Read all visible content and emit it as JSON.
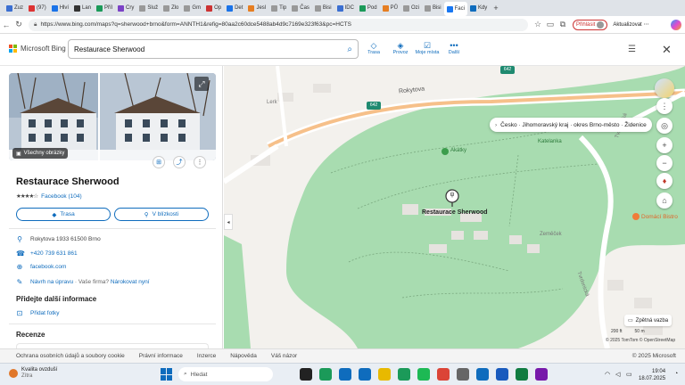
{
  "browser": {
    "tabs": [
      {
        "label": "Zuz",
        "color": "#3b6fd1"
      },
      {
        "label": "(97)",
        "color": "#d33"
      },
      {
        "label": "Hlví",
        "color": "#1a73e8"
      },
      {
        "label": "Lan",
        "color": "#333"
      },
      {
        "label": "Příl",
        "color": "#1b9a59"
      },
      {
        "label": "Cry",
        "color": "#7b42c6"
      },
      {
        "label": "Služ",
        "color": "#999"
      },
      {
        "label": "Zlo",
        "color": "#999"
      },
      {
        "label": "Gm",
        "color": "#999"
      },
      {
        "label": "Op",
        "color": "#c33"
      },
      {
        "label": "Det",
        "color": "#1a73e8"
      },
      {
        "label": "Jesl",
        "color": "#e67e22"
      },
      {
        "label": "Tip",
        "color": "#999"
      },
      {
        "label": "Čas",
        "color": "#999"
      },
      {
        "label": "Bisi",
        "color": "#999"
      },
      {
        "label": "IDC",
        "color": "#3b6fd1"
      },
      {
        "label": "Pod",
        "color": "#1b9a59"
      },
      {
        "label": "PŮ",
        "color": "#e67e22"
      },
      {
        "label": "Ozi",
        "color": "#999"
      },
      {
        "label": "Bisi",
        "color": "#999"
      },
      {
        "label": "Faci",
        "color": "#1877f2"
      },
      {
        "label": "Kdy",
        "color": "#0f6cbd"
      }
    ],
    "new_tab_glyph": "+",
    "url": "https://www.bing.com/maps?q=sherwood+brno&form=ANNTH1&refig=80aa2c60dce5488ab4d9c7169e323f63&pc=HCTS",
    "login_label": "Přihlásit",
    "update_label": "Aktualizovat"
  },
  "bing": {
    "brand": "Microsoft Bing",
    "search_value": "Restaurace Sherwood",
    "tools": [
      {
        "label": "Trasa",
        "icon": "directions-icon",
        "glyph": "◇"
      },
      {
        "label": "Provoz",
        "icon": "traffic-icon",
        "glyph": "◈"
      },
      {
        "label": "Moje místa",
        "icon": "places-icon",
        "glyph": "☑"
      },
      {
        "label": "Další",
        "icon": "more-icon",
        "glyph": "•••"
      }
    ]
  },
  "panel": {
    "all_images_label": "Všechny obrázky",
    "title": "Restaurace Sherwood",
    "rating_stars": 4,
    "rating_source": "Facebook (104)",
    "route_label": "Trasa",
    "nearby_label": "V blízkosti",
    "address": "Rokytova 1933 61500 Brno",
    "phone": "+420 739 631 861",
    "website": "facebook.com",
    "suggest_edit": "Návrh na úpravu",
    "own_business": " · Vaše firma? ",
    "claim_label": "Nárokovat nyní",
    "add_more_title": "Přidejte další informace",
    "add_photos_label": "Přidat fotky",
    "reviews_title": "Recenze"
  },
  "map": {
    "breadcrumb": "Česko · Jihomoravský kraj · okres Brno-město · Židenice",
    "road_rokytova": "Rokytova",
    "road_number": "642",
    "road_tvrdonicka": "Tvrdonická",
    "poi_akatky": "Akátky",
    "poi_katelanka": "Katelanka",
    "poi_restaurant": "Restaurace Sherwood",
    "poi_zemecky": "Zeměček",
    "poi_bistro": "Domácí Bistro",
    "area_lerk": "Lerk",
    "feedback_label": "Zpětná vazba",
    "scale_ft": "200 ft",
    "scale_m": "50 m",
    "copyright": "© 2025 TomTom  © OpenStreetMap"
  },
  "footer": {
    "links": [
      "Ochrana osobních údajů a soubory cookie",
      "Právní informace",
      "Inzerce",
      "Nápověda",
      "Váš názor"
    ],
    "copyright": "© 2025 Microsoft"
  },
  "taskbar": {
    "weather_title": "Kvalita ovzduší",
    "weather_sub": "Zítra",
    "search_placeholder": "Hledat",
    "time": "19:04",
    "date": "18.07.2025",
    "apps": [
      {
        "name": "start",
        "color": "#0f6cbd"
      },
      {
        "name": "cursor-app",
        "color": "#222"
      },
      {
        "name": "edge",
        "color": "#1b9a59"
      },
      {
        "name": "edge-2",
        "color": "#0f6cbd"
      },
      {
        "name": "outlook",
        "color": "#0f6cbd"
      },
      {
        "name": "files",
        "color": "#e8b900"
      },
      {
        "name": "check",
        "color": "#1b9a59"
      },
      {
        "name": "spotify",
        "color": "#1db954"
      },
      {
        "name": "chrome",
        "color": "#db4437"
      },
      {
        "name": "notification",
        "color": "#666"
      },
      {
        "name": "edge-3",
        "color": "#0f6cbd"
      },
      {
        "name": "word",
        "color": "#185abd"
      },
      {
        "name": "excel",
        "color": "#107c41"
      },
      {
        "name": "onenote",
        "color": "#7719aa"
      }
    ]
  }
}
